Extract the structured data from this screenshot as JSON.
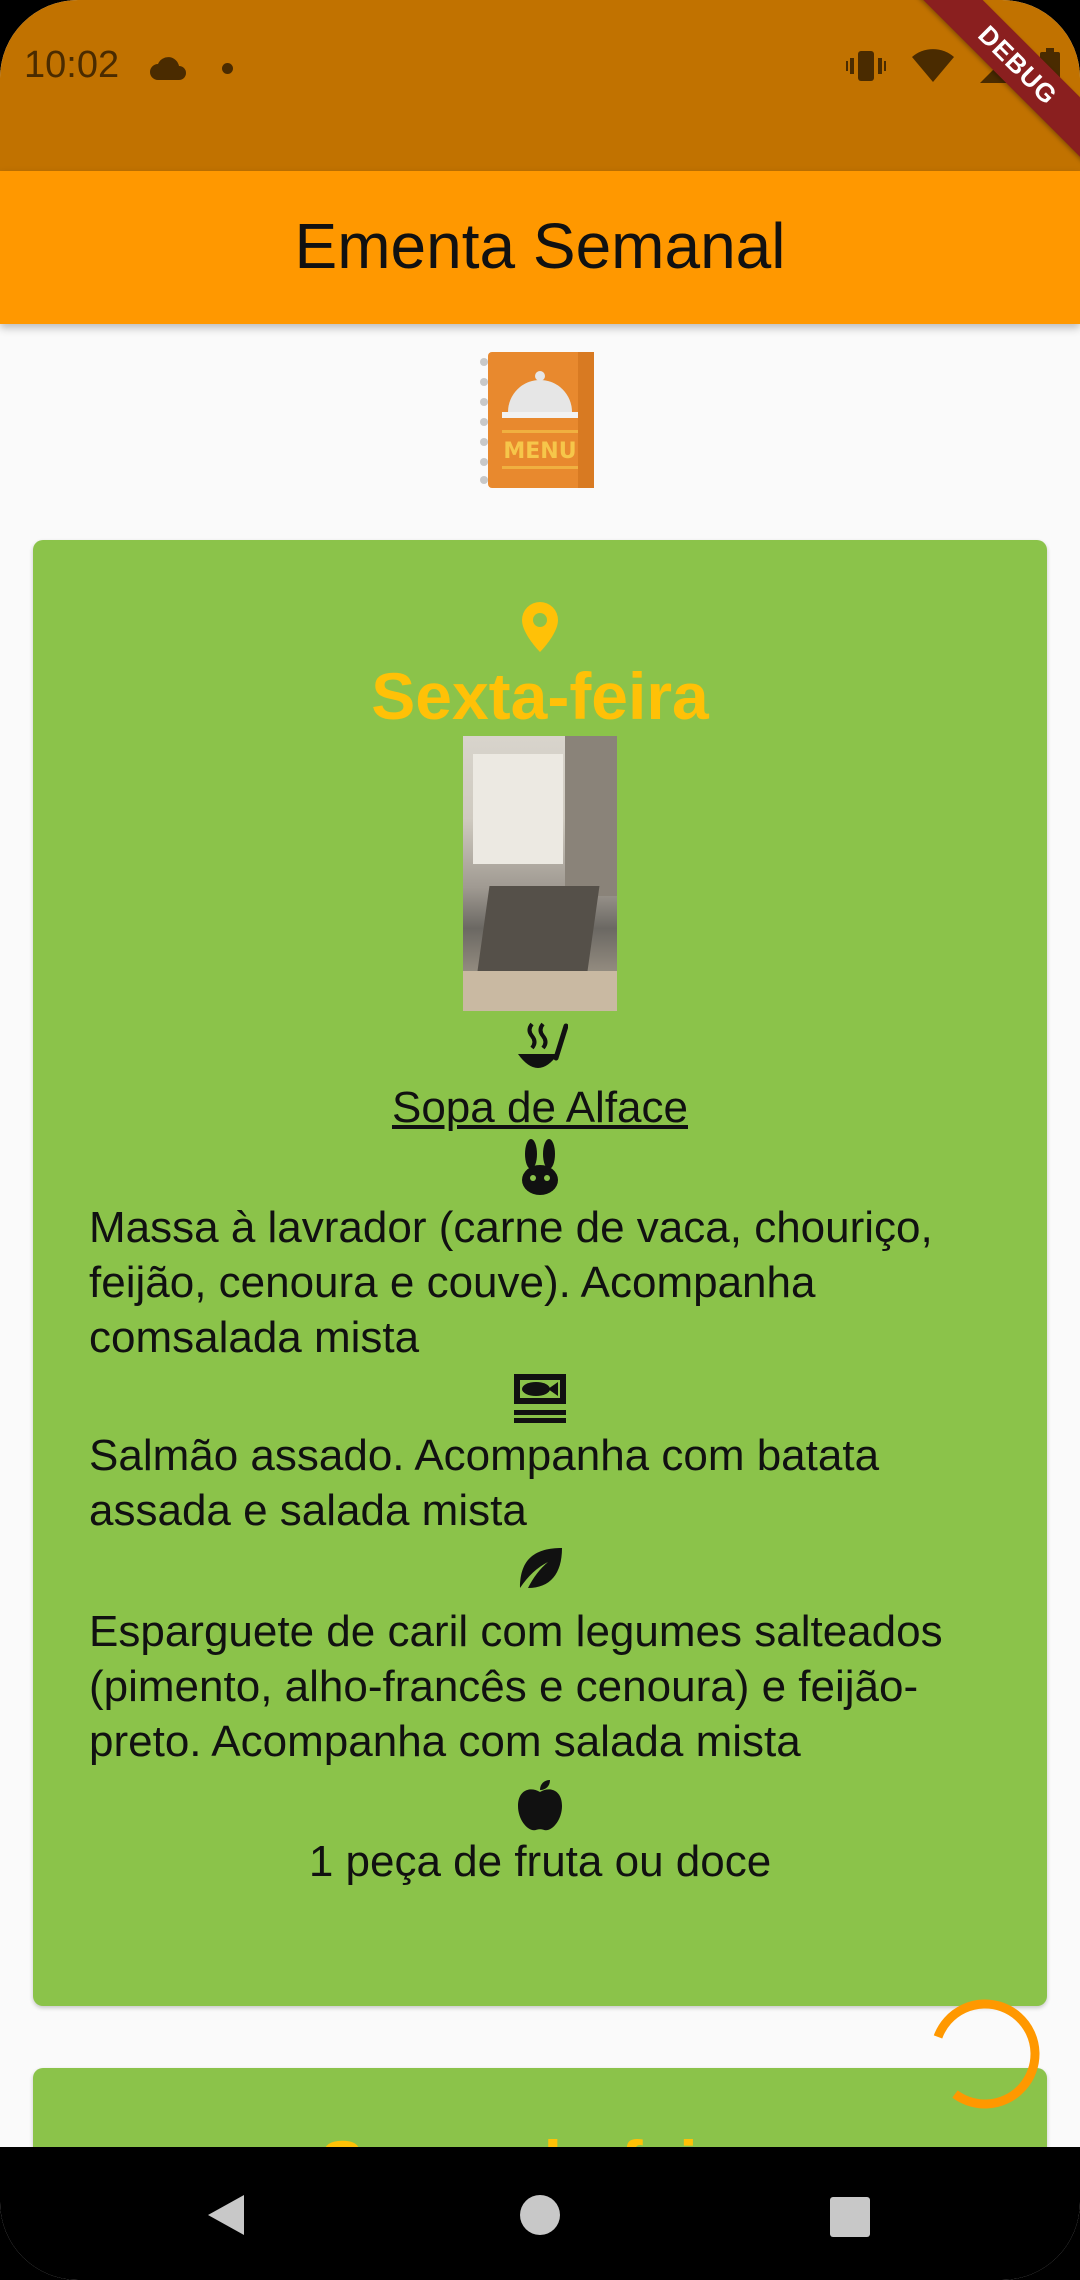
{
  "status_bar": {
    "time": "10:02",
    "debug_label": "DEBUG"
  },
  "app_bar": {
    "title": "Ementa Semanal"
  },
  "logo": {
    "label": "MENU"
  },
  "days": [
    {
      "day": "Sexta-feira",
      "soup": "Sopa de Alface",
      "meat": "Massa à lavrador (carne de vaca, chouriço, feijão, cenoura e couve). Acompanha comsalada mista",
      "fish": "Salmão assado. Acompanha com batata assada e salada mista",
      "vegetarian_line1": "Esparguete de caril com legumes salteados (pimento, alho-francês e cenoura) e feijão-",
      "vegetarian_line2": "preto. Acompanha com salada mista",
      "dessert": "1 peça de fruta ou doce"
    },
    {
      "day": "Segunda-feira"
    }
  ],
  "colors": {
    "status_bar": "#c17200",
    "app_bar": "#ff9800",
    "card": "#8bc34a",
    "day_title": "#ffc107",
    "background": "#fafafa"
  },
  "icons": [
    "cloud-icon",
    "vibrate-icon",
    "wifi-icon",
    "signal-icon",
    "battery-icon",
    "location-pin-icon",
    "soup-icon",
    "rabbit-icon",
    "fish-icon",
    "leaf-icon",
    "apple-icon",
    "back-icon",
    "home-icon",
    "recents-icon"
  ]
}
